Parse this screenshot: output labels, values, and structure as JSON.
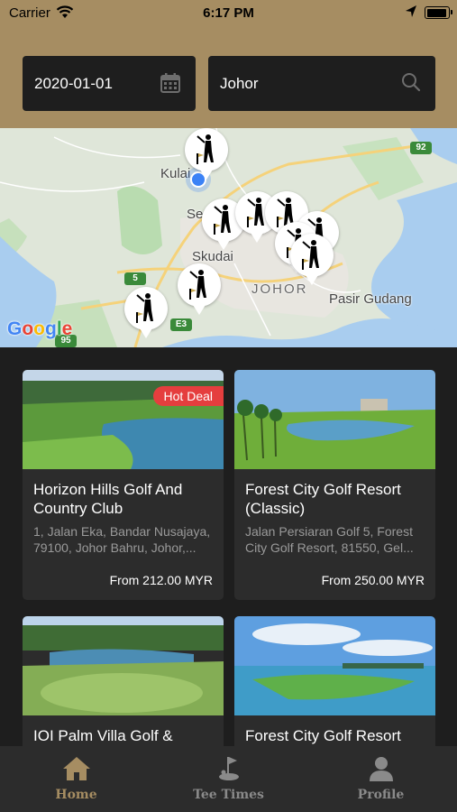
{
  "status_bar": {
    "carrier": "Carrier",
    "time": "6:17 PM"
  },
  "search": {
    "date": "2020-01-01",
    "location": "Johor"
  },
  "map": {
    "labels": {
      "kulai": "Kulai",
      "se": "Se",
      "skudai": "Skudai",
      "johor": "JOHOR",
      "pasir_gudang": "Pasir Gudang"
    },
    "shields": {
      "r92": "92",
      "r5": "5",
      "re3": "E3",
      "r95": "95"
    },
    "attribution": [
      "G",
      "o",
      "o",
      "g",
      "l",
      "e"
    ]
  },
  "courses": [
    {
      "name": "Horizon Hills Golf And Country Club",
      "address": "1, Jalan Eka, Bandar Nusajaya, 79100, Johor Bahru, Johor,...",
      "price": "From 212.00 MYR",
      "badge": "Hot Deal"
    },
    {
      "name": "Forest City Golf Resort (Classic)",
      "address": "Jalan Persiaran Golf 5, Forest City Golf Resort, 81550, Gel...",
      "price": "From 250.00 MYR"
    },
    {
      "name": "IOI Palm Villa Golf &",
      "address": "",
      "price": ""
    },
    {
      "name": "Forest City Golf Resort",
      "address": "",
      "price": ""
    }
  ],
  "tabs": {
    "home": "Home",
    "tee_times": "Tee Times",
    "profile": "Profile"
  },
  "colors": {
    "accent": "#a68d62",
    "background": "#1e1e1e",
    "card": "#2c2c2c",
    "badge": "#e53e3e",
    "user_location": "#3b82f6"
  }
}
